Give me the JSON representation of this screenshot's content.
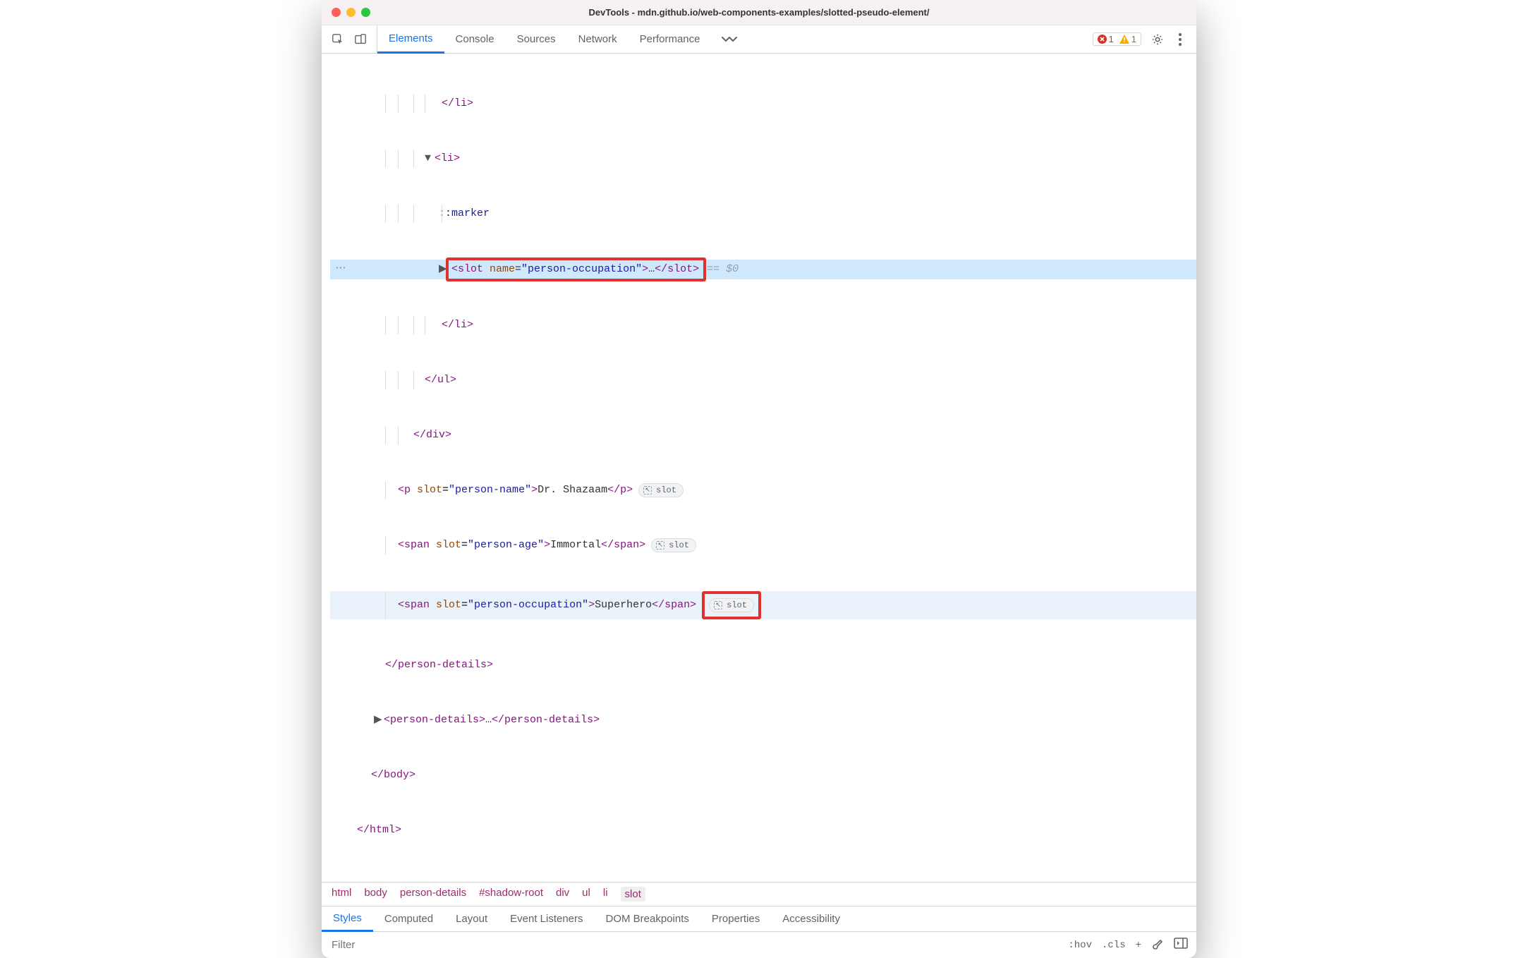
{
  "window": {
    "title": "DevTools - mdn.github.io/web-components-examples/slotted-pseudo-element/"
  },
  "tabs": {
    "elements": "Elements",
    "console": "Console",
    "sources": "Sources",
    "network": "Network",
    "performance": "Performance"
  },
  "warnings": {
    "error_count": "1",
    "warning_count": "1"
  },
  "dom": {
    "li_close": "</li>",
    "li_open": "<li>",
    "marker": "::marker",
    "slot_line": {
      "open": "<slot ",
      "attr": "name",
      "eq": "=",
      "val": "\"person-occupation\"",
      "gt": ">",
      "dots": "…",
      "close": "</slot>",
      "hint": " == $0"
    },
    "ul_close": "</ul>",
    "div_close": "</div>",
    "p_name": {
      "open": "<p ",
      "attr": "slot",
      "val": "\"person-name\"",
      "txt": "Dr. Shazaam",
      "close": "</p>"
    },
    "span_age": {
      "open": "<span ",
      "attr": "slot",
      "val": "\"person-age\"",
      "txt": "Immortal",
      "close": "</span>"
    },
    "span_occ": {
      "open": "<span ",
      "attr": "slot",
      "val": "\"person-occupation\"",
      "txt": "Superhero",
      "close": "</span>"
    },
    "pd_close": "</person-details>",
    "pd_collapsed": {
      "open": "<person-details>",
      "dots": "…",
      "close": "</person-details>"
    },
    "body_close": "</body>",
    "html_close": "</html>",
    "slot_badge": "slot",
    "ellipsis_left": "…"
  },
  "breadcrumb": [
    "html",
    "body",
    "person-details",
    "#shadow-root",
    "div",
    "ul",
    "li",
    "slot"
  ],
  "subtabs": [
    "Styles",
    "Computed",
    "Layout",
    "Event Listeners",
    "DOM Breakpoints",
    "Properties",
    "Accessibility"
  ],
  "filter": {
    "placeholder": "Filter",
    "hov": ":hov",
    "cls": ".cls",
    "plus": "+"
  }
}
